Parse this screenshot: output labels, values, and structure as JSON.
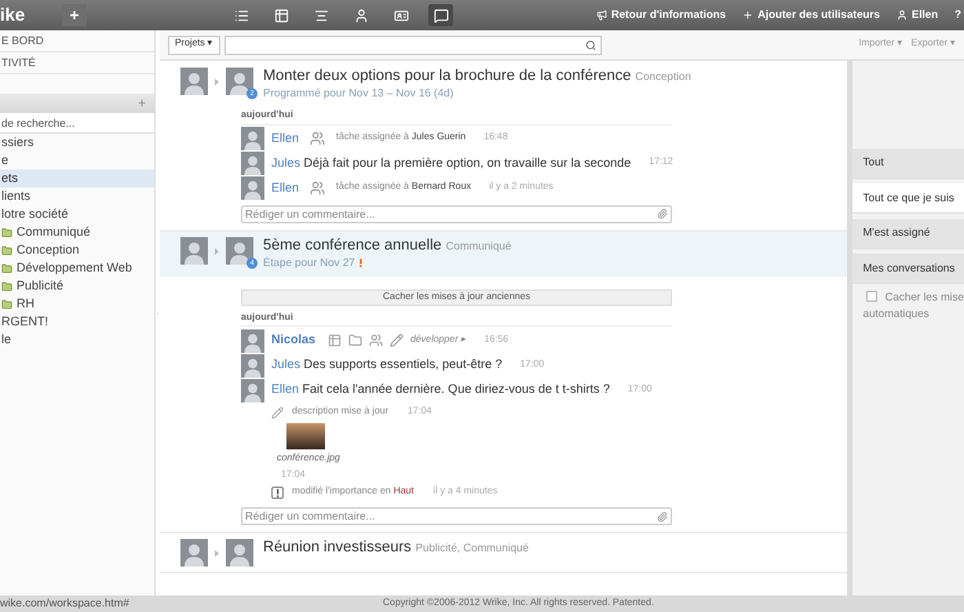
{
  "topbar": {
    "logo": "ike",
    "add_button": "+",
    "views": [
      {
        "selected": false
      },
      {
        "selected": false
      },
      {
        "selected": false
      },
      {
        "selected": false
      },
      {
        "selected": false
      },
      {
        "selected": true
      }
    ],
    "links": [
      {
        "label": "Retour d'informations"
      },
      {
        "label": "Ajouter des utilisateurs"
      },
      {
        "label": "Ellen"
      },
      {
        "label": "?"
      }
    ]
  },
  "sidebar": {
    "nav": [
      "E BORD",
      "TIVITÉ"
    ],
    "section_add": "+",
    "search": {
      "placeholder": "de recherche..."
    },
    "tree": [
      {
        "label": "ssiers",
        "selected": false
      },
      {
        "label": "e",
        "selected": false
      },
      {
        "label": "ets",
        "selected": true,
        "children": [
          {
            "label": "lients",
            "selected": false
          },
          {
            "label": "lotre société",
            "selected": false,
            "children": [
              {
                "label": "Communiqué",
                "selected": false
              },
              {
                "label": "Conception",
                "selected": false
              },
              {
                "label": "Développement Web",
                "selected": false
              },
              {
                "label": "Publicité",
                "selected": false
              },
              {
                "label": "RH",
                "selected": false
              }
            ]
          }
        ]
      },
      {
        "label": "RGENT!",
        "selected": false
      },
      {
        "label": "le",
        "selected": false
      }
    ]
  },
  "toolbar": {
    "scope": "Projets ▾",
    "actions": [
      "Importer ▾",
      "Exporter ▾"
    ]
  },
  "feed": [
    {
      "title": "Monter deux options pour la brochure de la conférence",
      "tag": "Conception",
      "subtitle": "Programmé pour Nov 13 – Nov 16 (4d)",
      "important": false,
      "badge": "2",
      "highlighted": false,
      "day": "aujourd'hui",
      "activities": [
        {
          "kind": "assign",
          "author": "Ellen",
          "text": "tâche assignée à",
          "target": "Jules Guerin",
          "time": "16:48"
        },
        {
          "kind": "comment",
          "author": "Jules",
          "text": "Déjà fait pour la première option, on travaille sur la seconde",
          "time": "17:12"
        },
        {
          "kind": "assign",
          "author": "Ellen",
          "text": "tâche assignée à",
          "target": "Bernard Roux",
          "time": "il y a 2 minutes"
        }
      ],
      "comment_placeholder": "Rédiger un commentaire..."
    },
    {
      "title": "5ème conférence annuelle",
      "tag": "Communiqué",
      "subtitle": "Étape pour Nov 27",
      "important": true,
      "badge": "4",
      "highlighted": true,
      "hide_button": "Cacher les mises à jour anciennes",
      "day": "aujourd'hui",
      "activities": [
        {
          "kind": "changes",
          "author": "Nicolas",
          "text": "développer ▸",
          "time": "16:56"
        },
        {
          "kind": "comment",
          "author": "Jules",
          "text": "Des supports essentiels, peut-être ?",
          "time": "17:00"
        },
        {
          "kind": "comment",
          "author": "Ellen",
          "text": "Fait cela l'année dernière. Que diriez-vous de t t-shirts ?",
          "time": "17:00"
        },
        {
          "kind": "edit",
          "text": "description mise à jour",
          "time": "17:04"
        },
        {
          "kind": "attachment",
          "text": "conférence.jpg",
          "time": "17:04"
        },
        {
          "kind": "importance",
          "text": "modifié l'importance en",
          "target": "Haut",
          "time": "il y a 4 minutes"
        }
      ],
      "comment_placeholder": "Rédiger un commentaire..."
    },
    {
      "title": "Réunion investisseurs",
      "tag": "Publicité, Communiqué",
      "important": false,
      "highlighted": false
    }
  ],
  "filters": {
    "items": [
      {
        "label": "Tout",
        "selected": false
      },
      {
        "label": "Tout ce que je suis",
        "selected": true
      },
      {
        "label": "M'est assigné",
        "selected": false
      },
      {
        "label": "Mes conversations",
        "selected": false
      }
    ],
    "option": {
      "label_lines": [
        "Cacher les mise",
        "automatiques"
      ],
      "checked": false
    }
  },
  "status_bar": {
    "url": "wike.com/workspace.htm#",
    "copyright": "Copyright ©2006-2012 Wrike, Inc. All rights reserved. Patented."
  }
}
